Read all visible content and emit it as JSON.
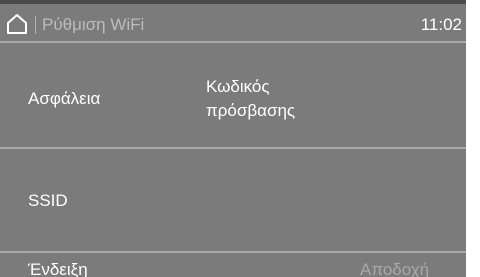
{
  "header": {
    "home_icon": "home-icon",
    "title": "Ρύθμιση WiFi",
    "time": "11:02"
  },
  "rows": [
    {
      "label": "Ασφάλεια",
      "value_line1": "Κωδικός",
      "value_line2": "πρόσβασης"
    },
    {
      "label": "SSID"
    }
  ],
  "footer": {
    "left_label": "Ένδειξη",
    "right_label": "Αποδοχή"
  },
  "colors": {
    "background": "#7b7b7b",
    "text": "#ffffff",
    "disabled_text": "#a9a9a9",
    "divider": "#a7a7a7"
  }
}
